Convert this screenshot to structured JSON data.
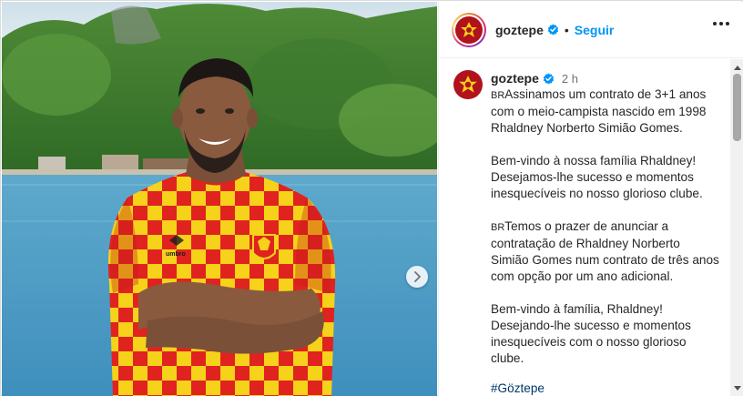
{
  "header": {
    "username": "goztepe",
    "separator": "•",
    "follow_label": "Seguir"
  },
  "caption": {
    "username": "goztepe",
    "time": "2 h",
    "paragraphs": [
      {
        "flag": "BR",
        "text": "Assinamos um contrato de 3+1 anos com o meio-campista nascido em 1998 Rhaldney Norberto Simião Gomes."
      },
      {
        "flag": "",
        "text": "Bem-vindo à nossa família Rhaldney! Desejamos-lhe sucesso e momentos inesquecíveis no nosso glorioso clube."
      },
      {
        "flag": "BR",
        "text": "Temos o prazer de anunciar a contratação de Rhaldney Norberto Simião Gomes num contrato de três anos com opção por um ano adicional."
      },
      {
        "flag": "",
        "text": "Bem-vindo à família, Rhaldney! Desejando-lhe sucesso e momentos inesquecíveis com o nosso glorioso clube."
      }
    ],
    "hashtag": "#Göztepe"
  },
  "photo": {
    "jersey_brand": "umbro"
  },
  "colors": {
    "follow": "#0095f6",
    "club_red": "#b1121b",
    "jersey_yellow": "#f6d21a",
    "hashtag": "#00376b",
    "verified": "#0095f6"
  },
  "icons": {
    "more": "more-options-icon",
    "verified": "verified-badge-icon",
    "next": "chevron-right-icon"
  }
}
